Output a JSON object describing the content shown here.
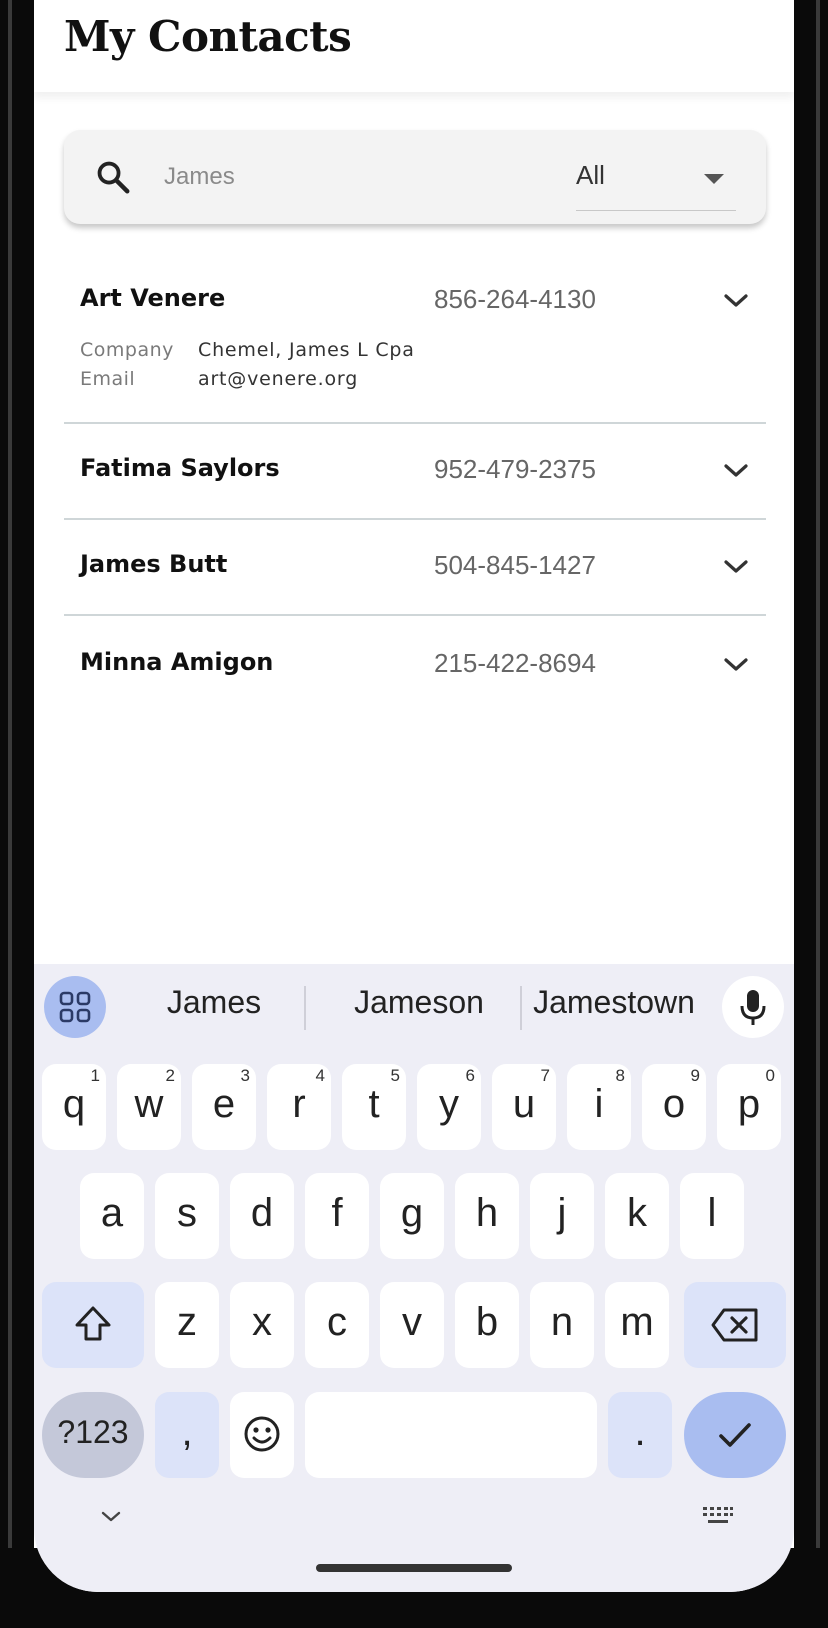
{
  "header": {
    "title": "My Contacts"
  },
  "search": {
    "placeholder": "James",
    "value": "",
    "filter": {
      "selected": "All"
    }
  },
  "contacts": [
    {
      "name": "Art Venere",
      "phone": "856-264-4130",
      "expanded": true,
      "details": [
        {
          "label": "Company",
          "value": "Chemel, James L Cpa"
        },
        {
          "label": "Email",
          "value": "art@venere.org"
        }
      ]
    },
    {
      "name": "Fatima Saylors",
      "phone": "952-479-2375",
      "expanded": false
    },
    {
      "name": "James Butt",
      "phone": "504-845-1427",
      "expanded": false
    },
    {
      "name": "Minna Amigon",
      "phone": "215-422-8694",
      "expanded": false
    }
  ],
  "keyboard": {
    "suggestions": [
      "James",
      "Jameson",
      "Jamestown"
    ],
    "row1": [
      {
        "key": "q",
        "hint": "1"
      },
      {
        "key": "w",
        "hint": "2"
      },
      {
        "key": "e",
        "hint": "3"
      },
      {
        "key": "r",
        "hint": "4"
      },
      {
        "key": "t",
        "hint": "5"
      },
      {
        "key": "y",
        "hint": "6"
      },
      {
        "key": "u",
        "hint": "7"
      },
      {
        "key": "i",
        "hint": "8"
      },
      {
        "key": "o",
        "hint": "9"
      },
      {
        "key": "p",
        "hint": "0"
      }
    ],
    "row2": [
      "a",
      "s",
      "d",
      "f",
      "g",
      "h",
      "j",
      "k",
      "l"
    ],
    "row3": [
      "z",
      "x",
      "c",
      "v",
      "b",
      "n",
      "m"
    ],
    "row4": {
      "symbols": "?123",
      "comma": ",",
      "period": "."
    },
    "icons": {
      "grid": "apps-grid-icon",
      "mic": "microphone-icon",
      "shift": "shift-icon",
      "backspace": "backspace-icon",
      "emoji": "emoji-icon",
      "enter": "checkmark-icon",
      "hide": "chevron-down-icon",
      "switch": "keyboard-icon"
    }
  },
  "colors": {
    "accent": "#a9bdf0",
    "key_special": "#dce3f9",
    "keyboard_bg": "#eeeef6",
    "divider": "#cfd6d8"
  }
}
